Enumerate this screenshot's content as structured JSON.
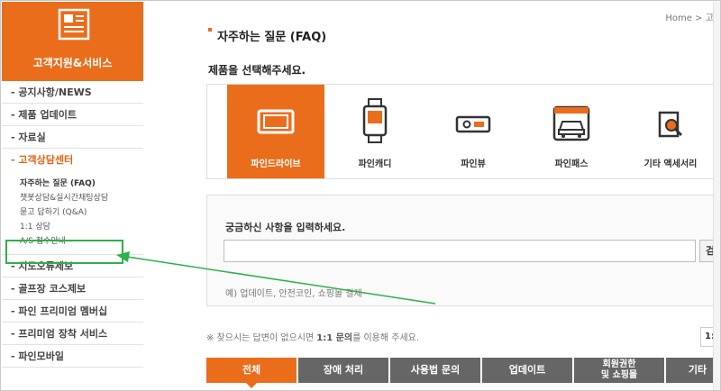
{
  "sidebar": {
    "header_title": "고객지원&서비스",
    "menu_1": "- 공지사항/NEWS",
    "menu_2": "- 제품 업데이트",
    "menu_3": "- 자료실",
    "menu_4": "- 고객상담센터",
    "sub_1": "자주하는 질문 (FAQ)",
    "sub_2": "챗봇상담&실시간채팅상담",
    "sub_3": "묻고 답하기 (Q&A)",
    "sub_4": "1:1 상담",
    "sub_5": "A/S 접수안내",
    "menu_5": "- 지도오류제보",
    "menu_6": "- 골프장 코스제보",
    "menu_7": "- 파인 프리미엄 멤버십",
    "menu_8": "- 프리미엄 장착 서비스",
    "menu_9": "- 파인모바일"
  },
  "main": {
    "breadcrumb": "Home > 고객",
    "page_title": "자주하는 질문 (FAQ)",
    "select_product_label": "제품을 선택해주세요.",
    "products": {
      "p1": "파인드라이브",
      "p2": "파인캐디",
      "p3": "파인뷰",
      "p4": "파인패스",
      "p5": "기타 액세서리"
    },
    "search": {
      "label": "궁금하신 사항을 입력하세요.",
      "input_value": "",
      "button": "검색",
      "example": "예) 업데이트, 안전코인, 쇼핑몰 결제"
    },
    "notice_pre": "※ 찾으시는 답변이 없으시면 ",
    "notice_link": "1:1 문의",
    "notice_post": "를 이용해 주세요.",
    "page_stub": "1:",
    "tabs": {
      "t1": "전체",
      "t2": "장애 처리",
      "t3": "사용법 문의",
      "t4": "업데이트",
      "t5_line1": "회원권한",
      "t5_line2": "및 쇼핑몰",
      "t6": "기타"
    }
  },
  "colors": {
    "accent": "#ea6d1c",
    "tab": "#666666",
    "highlight": "#2eb04a"
  },
  "icons": {
    "header": "document-icon",
    "p1": "navigation-monitor-icon",
    "p2": "golf-watch-icon",
    "p3": "dashcam-icon",
    "p4": "car-toll-icon",
    "p5": "magnifier-document-icon"
  }
}
